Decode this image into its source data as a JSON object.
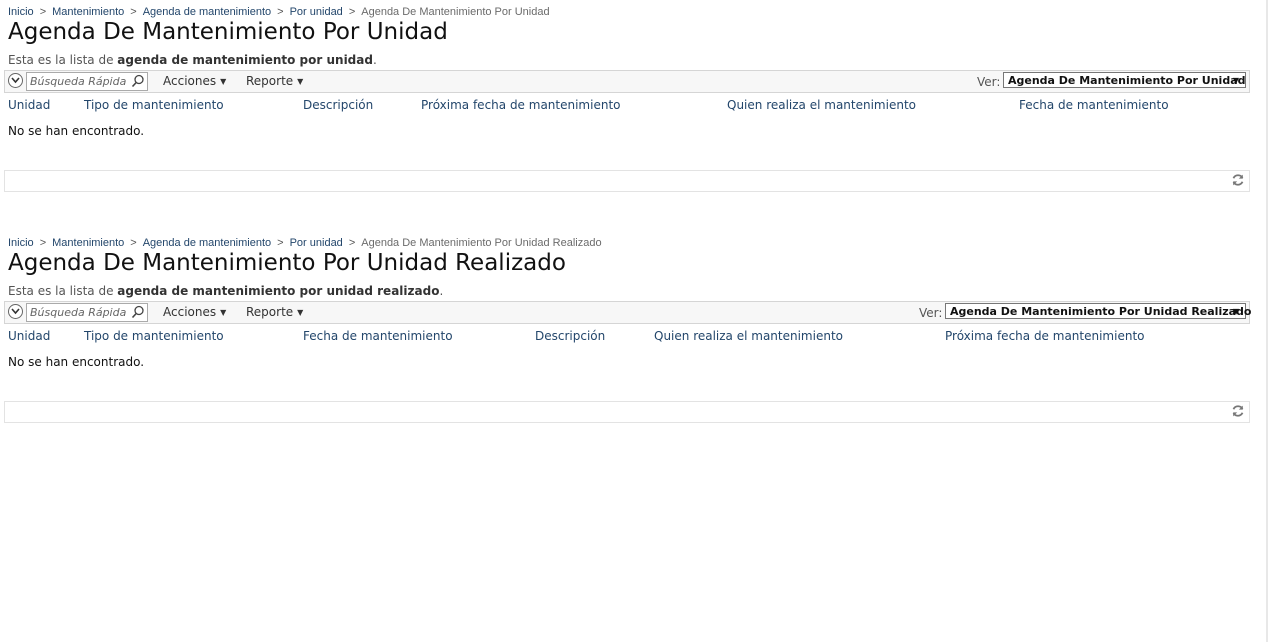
{
  "sections": [
    {
      "breadcrumb": [
        "Inicio",
        "Mantenimiento",
        "Agenda de mantenimiento",
        "Por unidad"
      ],
      "breadcrumb_current": "Agenda De Mantenimiento Por Unidad",
      "title": "Agenda De Mantenimiento Por Unidad",
      "desc_prefix": "Esta es la lista de",
      "desc_bold": "agenda de mantenimiento por unidad",
      "desc_suffix": ".",
      "search_placeholder": "Búsqueda Rápida",
      "acciones": "Acciones",
      "reporte": "Reporte",
      "ver_label": "Ver:",
      "ver_value": "Agenda De Mantenimiento Por Unidad",
      "columns": [
        "Unidad",
        "Tipo de mantenimiento",
        "Descripción",
        "Próxima fecha de mantenimiento",
        "Quien realiza el mantenimiento",
        "Fecha de mantenimiento"
      ],
      "empty": "No se han encontrado."
    },
    {
      "breadcrumb": [
        "Inicio",
        "Mantenimiento",
        "Agenda de mantenimiento",
        "Por unidad"
      ],
      "breadcrumb_current": "Agenda De Mantenimiento Por Unidad Realizado",
      "title": "Agenda De Mantenimiento Por Unidad Realizado",
      "desc_prefix": "Esta es la lista de",
      "desc_bold": "agenda de mantenimiento por unidad realizado",
      "desc_suffix": ".",
      "search_placeholder": "Búsqueda Rápida",
      "acciones": "Acciones",
      "reporte": "Reporte",
      "ver_label": "Ver:",
      "ver_value": "Agenda De Mantenimiento Por Unidad Realizado",
      "columns": [
        "Unidad",
        "Tipo de mantenimiento",
        "Fecha de mantenimiento",
        "Descripción",
        "Quien realiza el mantenimiento",
        "Próxima fecha de mantenimiento"
      ],
      "empty": "No se han encontrado."
    }
  ],
  "icons": {
    "collapse": "chevron-down-circle-icon",
    "search": "magnifier-icon",
    "refresh": "refresh-icon"
  },
  "colors": {
    "link": "#23466b",
    "toolbar_bg": "#f7f7f7",
    "border": "#d5d5d5"
  }
}
